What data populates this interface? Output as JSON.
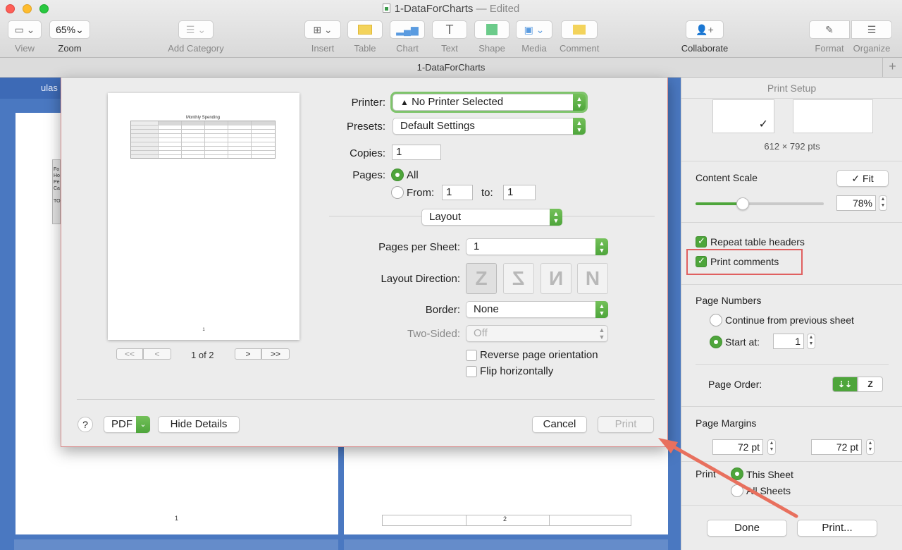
{
  "window": {
    "doc_title": "1-DataForCharts",
    "edited": "— Edited"
  },
  "toolbar": {
    "view": "View",
    "zoom_value": "65%",
    "zoom": "Zoom",
    "add_category": "Add Category",
    "insert": "Insert",
    "table": "Table",
    "chart": "Chart",
    "text": "Text",
    "shape": "Shape",
    "media": "Media",
    "comment": "Comment",
    "collaborate": "Collaborate",
    "format": "Format",
    "organize": "Organize"
  },
  "tabbar": {
    "sheet_name": "1-DataForCharts",
    "add": "+"
  },
  "canvas": {
    "partial_text": "ulas",
    "page1_num": "1",
    "page2_num": "2",
    "row_labels": [
      "Fo",
      "Ho",
      "Pe",
      "Ca",
      "TO"
    ]
  },
  "dialog": {
    "preview": {
      "title": "Monthly Spending",
      "page_num": "1",
      "page_indicator": "1 of 2",
      "first": "<<",
      "prev": "<",
      "next": ">",
      "last": ">>"
    },
    "printer_label": "Printer:",
    "printer_value": "No Printer Selected",
    "presets_label": "Presets:",
    "presets_value": "Default Settings",
    "copies_label": "Copies:",
    "copies_value": "1",
    "pages_label": "Pages:",
    "pages_all": "All",
    "pages_from": "From:",
    "pages_from_value": "1",
    "pages_to": "to:",
    "pages_to_value": "1",
    "section_value": "Layout",
    "pages_per_sheet_label": "Pages per Sheet:",
    "pages_per_sheet_value": "1",
    "layout_direction_label": "Layout Direction:",
    "border_label": "Border:",
    "border_value": "None",
    "two_sided_label": "Two-Sided:",
    "two_sided_value": "Off",
    "reverse_label": "Reverse page orientation",
    "flip_label": "Flip horizontally",
    "help": "?",
    "pdf": "PDF",
    "hide_details": "Hide Details",
    "cancel": "Cancel",
    "print": "Print"
  },
  "inspector": {
    "title": "Print Setup",
    "page_size": "612 × 792 pts",
    "content_scale_label": "Content Scale",
    "fit_button": "✓ Fit",
    "scale_value": "78%",
    "scale_fraction": 0.36,
    "repeat_headers": "Repeat table headers",
    "print_comments": "Print comments",
    "page_numbers_label": "Page Numbers",
    "continue_label": "Continue from previous sheet",
    "start_at_label": "Start at:",
    "start_at_value": "1",
    "page_order_label": "Page Order:",
    "page_margins_label": "Page Margins",
    "margin_top_value": "72 pt",
    "margin_bottom_value": "72 pt",
    "print_label": "Print",
    "this_sheet": "This Sheet",
    "all_sheets": "All Sheets",
    "done": "Done",
    "print_button": "Print..."
  },
  "colors": {
    "accent_green": "#4ea53b",
    "highlight_red": "#e06060",
    "canvas_blue": "#4a78c1"
  }
}
